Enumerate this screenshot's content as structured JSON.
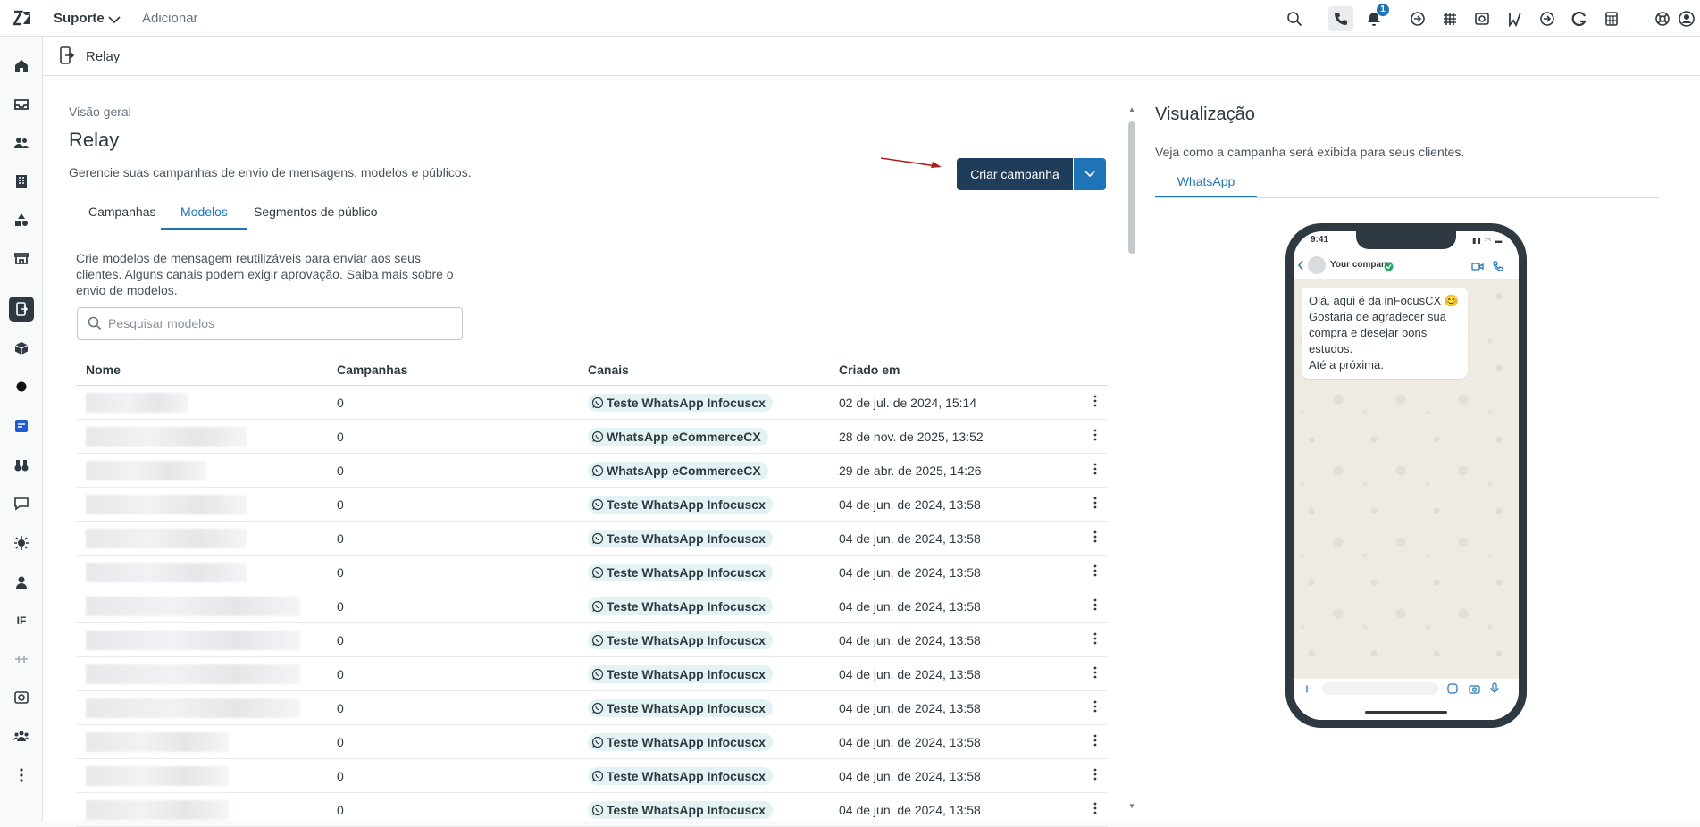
{
  "topbar": {
    "product": "Suporte",
    "add_label": "Adicionar",
    "notification_count": "1"
  },
  "app": {
    "title": "Relay"
  },
  "main": {
    "breadcrumb": "Visão geral",
    "title": "Relay",
    "description": "Gerencie suas campanhas de envio de mensagens, modelos e públicos.",
    "create_button": "Criar campanha",
    "tabs": [
      {
        "label": "Campanhas"
      },
      {
        "label": "Modelos"
      },
      {
        "label": "Segmentos de público"
      }
    ],
    "intro": "Crie modelos de mensagem reutilizáveis para enviar aos seus clientes. Alguns canais podem exigir aprovação. Saiba mais sobre o envio de modelos.",
    "search_placeholder": "Pesquisar modelos",
    "columns": [
      "Nome",
      "Campanhas",
      "Canais",
      "Criado em"
    ],
    "rows": [
      {
        "campanhas": "0",
        "canal": "Teste WhatsApp Infocuscx",
        "criado": "02 de jul. de 2024, 15:14"
      },
      {
        "campanhas": "0",
        "canal": "WhatsApp eCommerceCX",
        "criado": "28 de nov. de 2025, 13:52"
      },
      {
        "campanhas": "0",
        "canal": "WhatsApp eCommerceCX",
        "criado": "29 de abr. de 2025, 14:26"
      },
      {
        "campanhas": "0",
        "canal": "Teste WhatsApp Infocuscx",
        "criado": "04 de jun. de 2024, 13:58"
      },
      {
        "campanhas": "0",
        "canal": "Teste WhatsApp Infocuscx",
        "criado": "04 de jun. de 2024, 13:58"
      },
      {
        "campanhas": "0",
        "canal": "Teste WhatsApp Infocuscx",
        "criado": "04 de jun. de 2024, 13:58"
      },
      {
        "campanhas": "0",
        "canal": "Teste WhatsApp Infocuscx",
        "criado": "04 de jun. de 2024, 13:58"
      },
      {
        "campanhas": "0",
        "canal": "Teste WhatsApp Infocuscx",
        "criado": "04 de jun. de 2024, 13:58"
      },
      {
        "campanhas": "0",
        "canal": "Teste WhatsApp Infocuscx",
        "criado": "04 de jun. de 2024, 13:58"
      },
      {
        "campanhas": "0",
        "canal": "Teste WhatsApp Infocuscx",
        "criado": "04 de jun. de 2024, 13:58"
      },
      {
        "campanhas": "0",
        "canal": "Teste WhatsApp Infocuscx",
        "criado": "04 de jun. de 2024, 13:58"
      },
      {
        "campanhas": "0",
        "canal": "Teste WhatsApp Infocuscx",
        "criado": "04 de jun. de 2024, 13:58"
      },
      {
        "campanhas": "0",
        "canal": "Teste WhatsApp Infocuscx",
        "criado": "04 de jun. de 2024, 13:58"
      }
    ]
  },
  "preview": {
    "title": "Visualização",
    "description": "Veja como a campanha será exibida para seus clientes.",
    "tab": "WhatsApp",
    "phone_time": "9:41",
    "contact_name": "Your company",
    "message": "Olá, aqui é da inFocusCX 😊\nGostaria de agradecer sua compra e desejar bons estudos.\nAté a próxima."
  },
  "colors": {
    "primary_button": "#1f3c5a",
    "accent": "#1f73b7",
    "chip_bg": "#e3f2f3"
  }
}
